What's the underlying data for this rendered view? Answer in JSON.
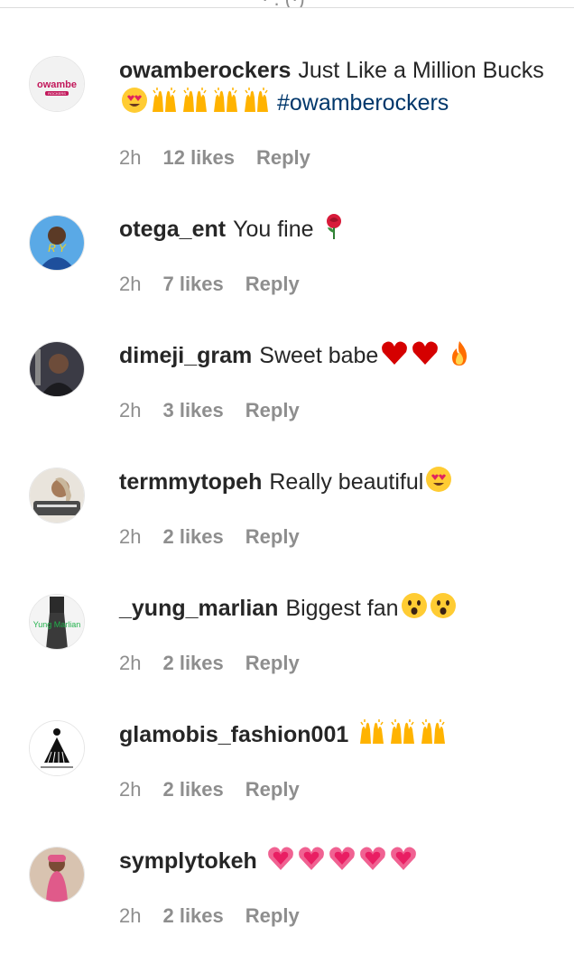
{
  "header": {
    "clipped_text": "· . (·)"
  },
  "comments": [
    {
      "username": "owamberockers",
      "text": "Just Like a Million Bucks",
      "emojis": [
        "heart-eyes",
        "raising-hands",
        "raising-hands",
        "raising-hands",
        "raising-hands"
      ],
      "hashtag": "#owamberockers",
      "time": "2h",
      "likes": "12 likes",
      "reply": "Reply",
      "avatar_label": "owambe",
      "avatar_sublabel": "ROCKERS"
    },
    {
      "username": "otega_ent",
      "text": "You fine",
      "emojis": [
        "rose"
      ],
      "time": "2h",
      "likes": "7 likes",
      "reply": "Reply",
      "avatar_label": "R Y"
    },
    {
      "username": "dimeji_gram",
      "text": "Sweet babe",
      "emojis": [
        "red-heart",
        "red-heart",
        "fire"
      ],
      "time": "2h",
      "likes": "3 likes",
      "reply": "Reply"
    },
    {
      "username": "termmytopeh",
      "text": "Really beautiful",
      "emojis": [
        "heart-eyes"
      ],
      "time": "2h",
      "likes": "2 likes",
      "reply": "Reply"
    },
    {
      "username": "_yung_marlian",
      "text": "Biggest fan",
      "emojis": [
        "hushed-face",
        "hushed-face"
      ],
      "time": "2h",
      "likes": "2 likes",
      "reply": "Reply",
      "avatar_label": "Yung Marlian"
    },
    {
      "username": "glamobis_fashion001",
      "text": "",
      "emojis": [
        "raising-hands",
        "raising-hands",
        "raising-hands"
      ],
      "time": "2h",
      "likes": "2 likes",
      "reply": "Reply"
    },
    {
      "username": "symplytokeh",
      "text": "",
      "emojis": [
        "growing-heart",
        "growing-heart",
        "growing-heart",
        "growing-heart",
        "growing-heart"
      ],
      "time": "2h",
      "likes": "2 likes",
      "reply": "Reply"
    }
  ],
  "colors": {
    "text": "#262626",
    "meta": "#8e8e8e",
    "hashtag": "#00376b",
    "divider": "#dbdbdb"
  }
}
